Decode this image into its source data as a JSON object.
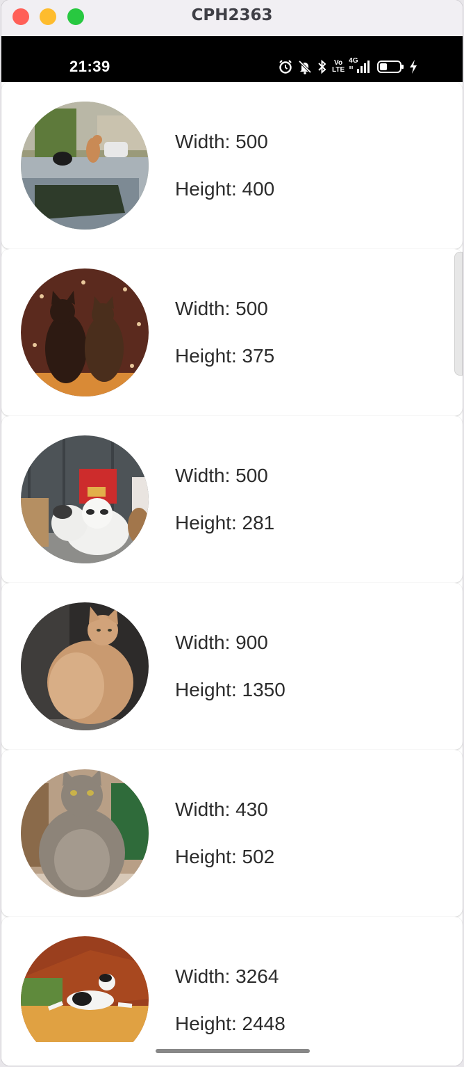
{
  "window": {
    "title": "CPH2363"
  },
  "status_bar": {
    "time": "21:39",
    "icons": [
      "alarm-icon",
      "mute-icon",
      "bluetooth-icon",
      "volte-icon",
      "4g-signal-icon",
      "battery-icon",
      "charging-icon"
    ],
    "net_label": "4G",
    "volte_top": "Vo",
    "volte_bottom": "LTE"
  },
  "images": [
    {
      "width_text": "Width: 500",
      "height_text": "Height: 400",
      "image": "cats-on-car-roof"
    },
    {
      "width_text": "Width: 500",
      "height_text": "Height: 375",
      "image": "two-cats-looking-at-lights"
    },
    {
      "width_text": "Width: 500",
      "height_text": "Height: 281",
      "image": "cat-with-fries-box-hat"
    },
    {
      "width_text": "Width: 900",
      "height_text": "Height: 1350",
      "image": "fluffy-orange-cat"
    },
    {
      "width_text": "Width: 430",
      "height_text": "Height: 502",
      "image": "fat-grey-cat-sitting"
    },
    {
      "width_text": "Width: 3264",
      "height_text": "Height: 2448",
      "image": "calico-cat-lying-on-blanket"
    }
  ]
}
